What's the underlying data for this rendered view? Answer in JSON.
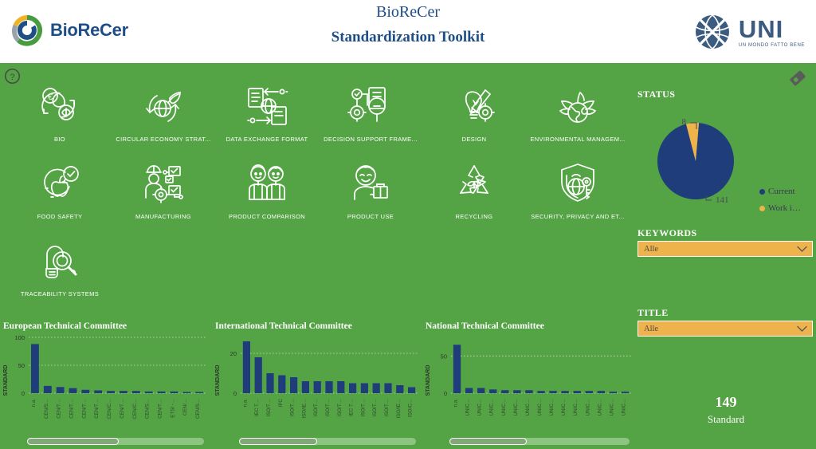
{
  "header": {
    "brand_left_text": "BioReCer",
    "main_title": "BioReCer",
    "sub_title": "Standardization Toolkit",
    "brand_right_text": "UNI",
    "brand_right_tagline": "UN MONDO FATTO BENE",
    "help_icon": "question-mark-circle-icon",
    "eraser_icon": "eraser-icon"
  },
  "icon_grid": {
    "items": [
      {
        "label": "BIO",
        "icon": "globe-euro-leaf-icon"
      },
      {
        "label": "CIRCULAR ECONOMY STRAT...",
        "icon": "circular-arrows-globe-leaf-icon"
      },
      {
        "label": "DATA EXCHANGE FORMAT",
        "icon": "document-globe-exchange-icon"
      },
      {
        "label": "DECISION SUPPORT FRAME...",
        "icon": "document-magnifier-gear-icon"
      },
      {
        "label": "DESIGN",
        "icon": "lightbulb-pencil-gear-icon"
      },
      {
        "label": "ENVIRONMENTAL MANAGEM...",
        "icon": "globe-leaves-icon"
      },
      {
        "label": "FOOD SAFETY",
        "icon": "apple-check-icon"
      },
      {
        "label": "MANUFACTURING",
        "icon": "worker-gear-flowchart-icon"
      },
      {
        "label": "PRODUCT COMPARISON",
        "icon": "two-people-icon"
      },
      {
        "label": "PRODUCT USE",
        "icon": "person-package-icon"
      },
      {
        "label": "RECYCLING",
        "icon": "recycling-leaf-icon"
      },
      {
        "label": "SECURITY, PRIVACY AND ET...",
        "icon": "shield-globe-key-icon"
      },
      {
        "label": "TRACEABILITY SYSTEMS",
        "icon": "package-magnifier-icon"
      }
    ]
  },
  "right_panel": {
    "status_title": "STATUS",
    "keywords_title": "KEYWORDS",
    "title_title": "TITLE",
    "keywords_value": "Alle",
    "title_value": "Alle",
    "caret_icon": "chevron-down-icon",
    "kpi_number": "149",
    "kpi_label": "Standard"
  },
  "colors": {
    "background_green": "#54a344",
    "bar_blue": "#1f3d7a",
    "pie_blue": "#1f3d7a",
    "pie_yellow": "#efb34c",
    "dropdown_amber": "#efb34c",
    "brand_blue": "#1f4e87"
  },
  "chart_data": [
    {
      "type": "pie",
      "id": "status-pie",
      "title": "STATUS",
      "categories": [
        "Current",
        "Work i…"
      ],
      "values": [
        141,
        8
      ],
      "labels": [
        "141",
        "8"
      ],
      "colors": [
        "#1f3d7a",
        "#efb34c"
      ],
      "legend": [
        "Current",
        "Work i…"
      ],
      "legend_position": "right"
    },
    {
      "type": "bar",
      "id": "european-technical-committee",
      "title": "European Technical Committee",
      "xlabel": "",
      "ylabel": "STANDARD",
      "ylim": [
        0,
        100
      ],
      "yticks": [
        0,
        50,
        100
      ],
      "grid": true,
      "categories": [
        "n.a.",
        "CEN/S…",
        "CEN/T…",
        "CEN/T…",
        "CEN/T…",
        "CEN/T…",
        "CEN/C…",
        "CEN/T…",
        "CEN/C…",
        "CEN/S…",
        "CEN/T…",
        "ETSI -…",
        "CEN/…",
        "CEN/S…"
      ],
      "values": [
        88,
        13,
        11,
        9,
        6,
        5,
        4,
        4,
        4,
        3,
        3,
        3,
        2,
        2
      ],
      "scrollbar": {
        "thumb_fraction": 0.52
      }
    },
    {
      "type": "bar",
      "id": "international-technical-committee",
      "title": "International Technical Committee",
      "xlabel": "",
      "ylabel": "STANDARD",
      "ylim": [
        0,
        28
      ],
      "yticks": [
        0,
        20
      ],
      "grid": true,
      "categories": [
        "n.a.",
        "IEC T…",
        "ISO/T…",
        "IPC",
        "ISO/T…",
        "ISO/IE…",
        "ISO/T…",
        "ISO/T…",
        "ISO/T…",
        "IEC T…",
        "ISO/T…",
        "ISO/T…",
        "ISO/T…",
        "ISO/IE…",
        "ISO/C…"
      ],
      "values": [
        26,
        18,
        10,
        9,
        8,
        6,
        6,
        6,
        6,
        5,
        5,
        5,
        5,
        4,
        3
      ],
      "scrollbar": {
        "thumb_fraction": 0.44
      }
    },
    {
      "type": "bar",
      "id": "national-technical-committee",
      "title": "National Technical Committee",
      "xlabel": "",
      "ylabel": "STANDARD",
      "ylim": [
        0,
        75
      ],
      "yticks": [
        0,
        50
      ],
      "grid": true,
      "categories": [
        "n.a.",
        "UNIC…",
        "UNIC…",
        "UNIC…",
        "UNIC…",
        "UNIC…",
        "UNIC…",
        "UNIC…",
        "UNIC…",
        "UNIC…",
        "UNIC…",
        "UNIC…",
        "UNIC…",
        "UNIC…",
        "UNIC…"
      ],
      "values": [
        65,
        7,
        7,
        5,
        4,
        4,
        4,
        3,
        3,
        3,
        3,
        3,
        3,
        2,
        2
      ],
      "scrollbar": {
        "thumb_fraction": 0.43
      }
    }
  ]
}
